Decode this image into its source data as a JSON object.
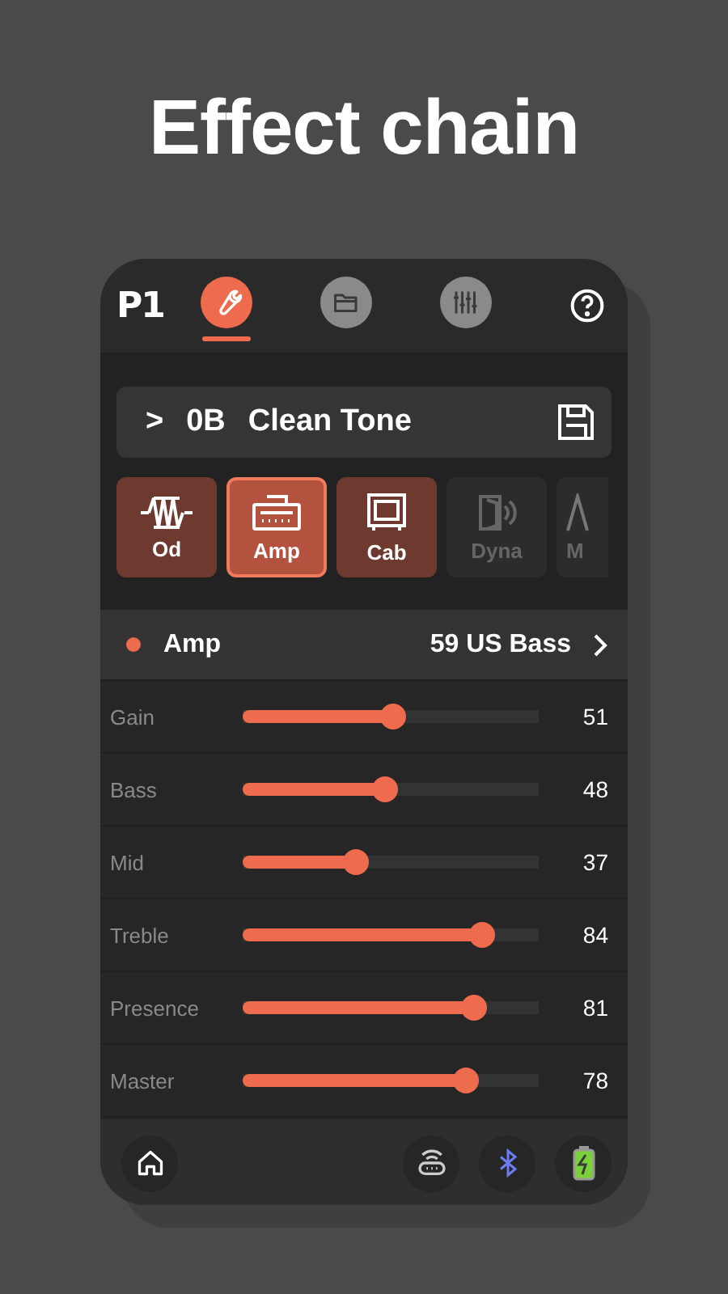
{
  "headline": "Effect chain",
  "app": {
    "logo": "P1",
    "nav_tabs": [
      {
        "kind": "wrench",
        "selected": true
      },
      {
        "kind": "folder",
        "selected": false
      },
      {
        "kind": "mixer",
        "selected": false
      }
    ],
    "preset": {
      "caret": ">",
      "number": "0B",
      "name": "Clean Tone"
    },
    "effect_blocks": [
      {
        "kind": "od",
        "label": "Od",
        "enabled": true,
        "selected": false
      },
      {
        "kind": "amp",
        "label": "Amp",
        "enabled": true,
        "selected": true
      },
      {
        "kind": "cab",
        "label": "Cab",
        "enabled": true,
        "selected": false
      },
      {
        "kind": "dyna",
        "label": "Dyna",
        "enabled": false,
        "selected": false
      },
      {
        "kind": "mod",
        "label": "M",
        "enabled": false,
        "selected": false
      }
    ],
    "module": {
      "name": "Amp",
      "model": "59 US Bass",
      "color": "#ee6b4d"
    },
    "params": [
      {
        "name": "Gain",
        "level": 0.51,
        "reading": "51"
      },
      {
        "name": "Bass",
        "level": 0.48,
        "reading": "48"
      },
      {
        "name": "Mid",
        "level": 0.37,
        "reading": "37"
      },
      {
        "name": "Treble",
        "level": 0.84,
        "reading": "84"
      },
      {
        "name": "Presence",
        "level": 0.81,
        "reading": "81"
      },
      {
        "name": "Master",
        "level": 0.78,
        "reading": "78"
      }
    ]
  }
}
